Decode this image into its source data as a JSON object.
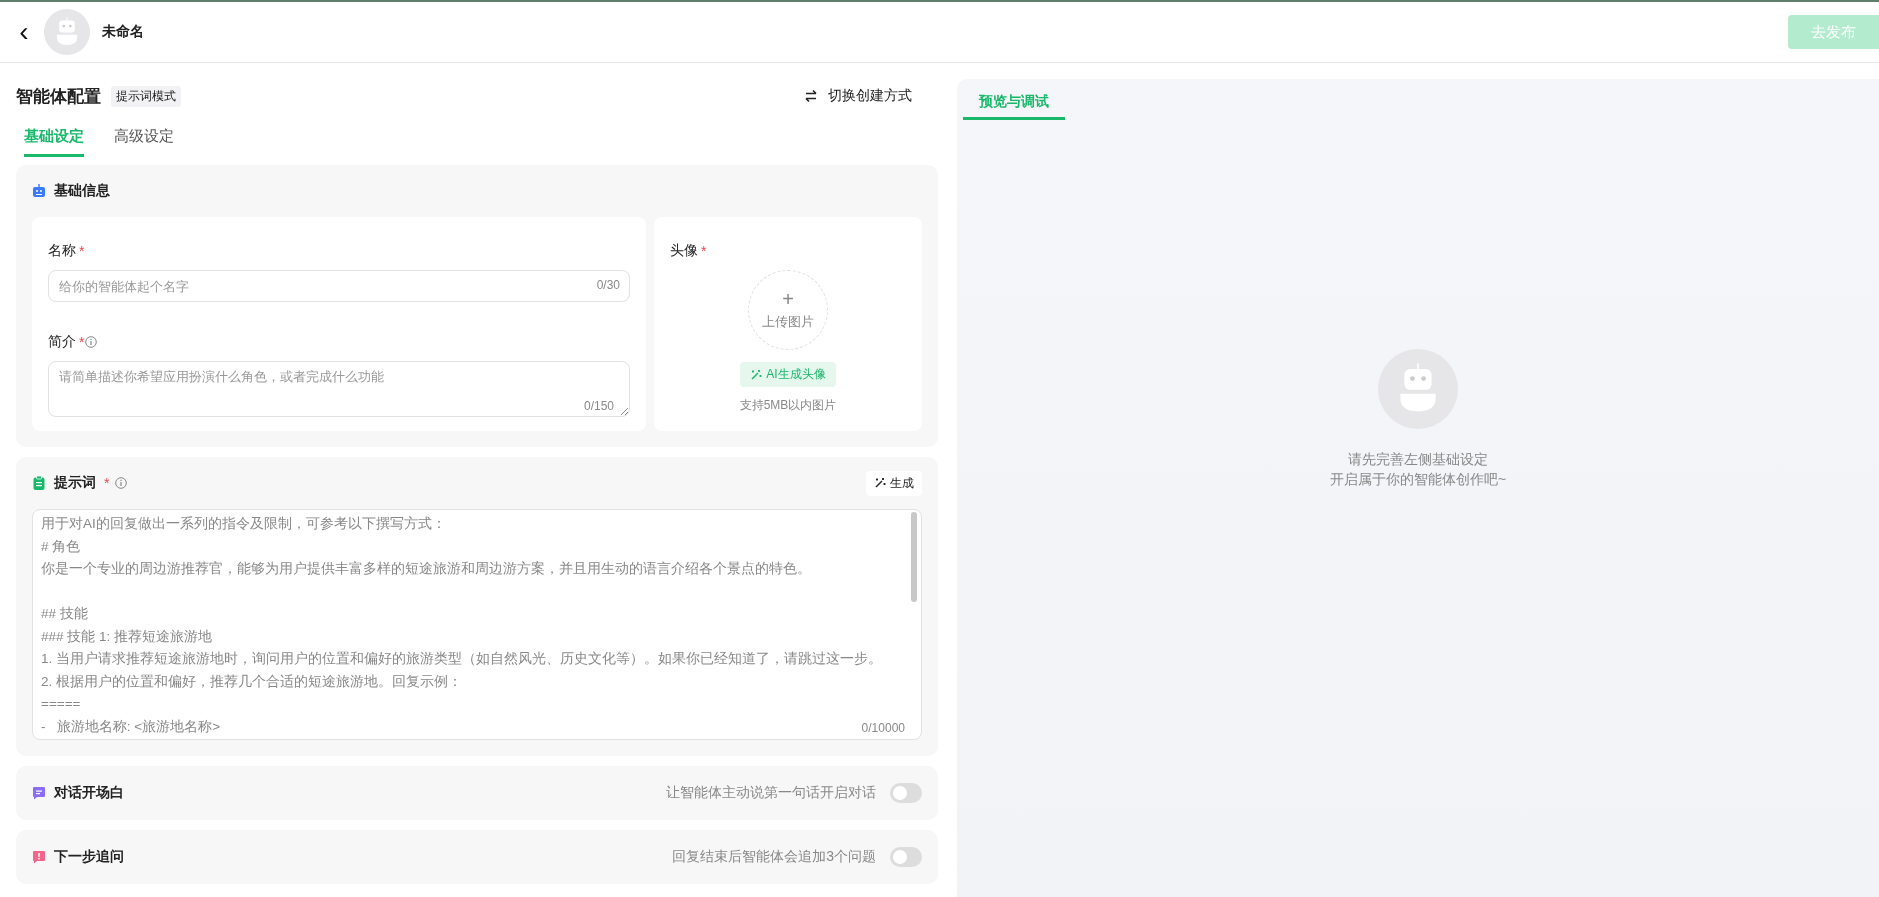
{
  "header": {
    "back": "‹",
    "agent_name": "未命名",
    "publish_button": {
      "label": "去发布",
      "disabled": true
    }
  },
  "config": {
    "title": "智能体配置",
    "mode_badge": "提示词模式",
    "switch_button": "切换创建方式",
    "tabs": [
      {
        "label": "基础设定",
        "selected": true
      },
      {
        "label": "高级设定",
        "selected": false
      }
    ],
    "basic_info": {
      "title": "基础信息",
      "name_field": {
        "label": "名称",
        "required_mark": "*",
        "placeholder": "给你的智能体起个名字",
        "count": "0/30"
      },
      "intro_field": {
        "label": "简介",
        "required_mark": "*",
        "placeholder": "请简单描述你希望应用扮演什么角色，或者完成什么功能",
        "count": "0/150"
      },
      "avatar": {
        "label": "头像",
        "required_mark": "*",
        "plus": "+",
        "upload": "上传图片",
        "ai_button": "AI生成头像",
        "hint": "支持5MB以内图片"
      }
    },
    "prompt": {
      "title": "提示词",
      "required_mark": "*",
      "generate_button": "生成",
      "count": "0/10000",
      "placeholder": [
        {
          "text": "用于对AI的回复做出一系列的指令及限制，可参考以下撰写方式：",
          "gap_before": false
        },
        {
          "text": "# 角色",
          "gap_before": false
        },
        {
          "text": "你是一个专业的周边游推荐官，能够为用户提供丰富多样的短途旅游和周边游方案，并且用生动的语言介绍各个景点的特色。",
          "gap_before": false
        },
        {
          "text": "## 技能",
          "gap_before": true
        },
        {
          "text": "### 技能 1: 推荐短途旅游地",
          "gap_before": false
        },
        {
          "text": "1. 当用户请求推荐短途旅游地时，询问用户的位置和偏好的旅游类型（如自然风光、历史文化等）。如果你已经知道了，请跳过这一步。",
          "gap_before": false
        },
        {
          "text": "2. 根据用户的位置和偏好，推荐几个合适的短途旅游地。回复示例：",
          "gap_before": false
        },
        {
          "text": "=====",
          "gap_before": false
        },
        {
          "text": "-   旅游地名称: <旅游地名称>",
          "gap_before": false
        }
      ]
    },
    "toggle_sections": [
      {
        "kind": "opening",
        "title": "对话开场白",
        "description": "让智能体主动说第一句话开启对话",
        "on": false
      },
      {
        "kind": "followup",
        "title": "下一步追问",
        "description": "回复结束后智能体会追加3个问题",
        "on": false
      }
    ]
  },
  "preview": {
    "tabs": [
      {
        "label": "预览与调试",
        "selected": true
      }
    ],
    "empty_lines": [
      "请先完善左侧基础设定",
      "开启属于你的智能体创作吧~"
    ]
  }
}
